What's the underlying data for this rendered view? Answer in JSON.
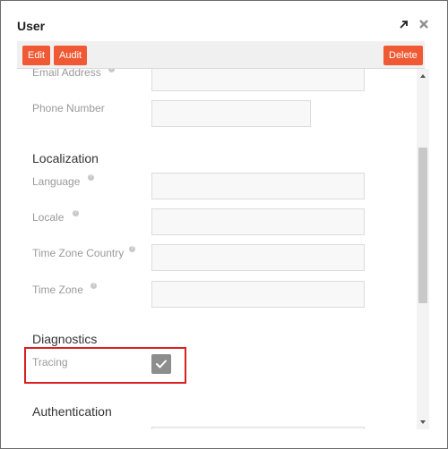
{
  "dialog": {
    "title": "User"
  },
  "toolbar": {
    "edit_label": "Edit",
    "audit_label": "Audit",
    "delete_label": "Delete"
  },
  "fields": {
    "email_label": "Email Address",
    "phone_label": "Phone Number",
    "language_label": "Language",
    "locale_label": "Locale",
    "tz_country_label": "Time Zone Country",
    "tz_label": "Time Zone",
    "tracing_label": "Tracing"
  },
  "sections": {
    "localization": "Localization",
    "diagnostics": "Diagnostics",
    "authentication": "Authentication"
  },
  "colors": {
    "accent": "#ef5a34",
    "highlight": "#d9201e"
  },
  "icons": {
    "expand": "expand-arrow-icon",
    "close": "close-icon",
    "check": "check-icon",
    "help": "help-icon"
  },
  "tracing_checked": true
}
